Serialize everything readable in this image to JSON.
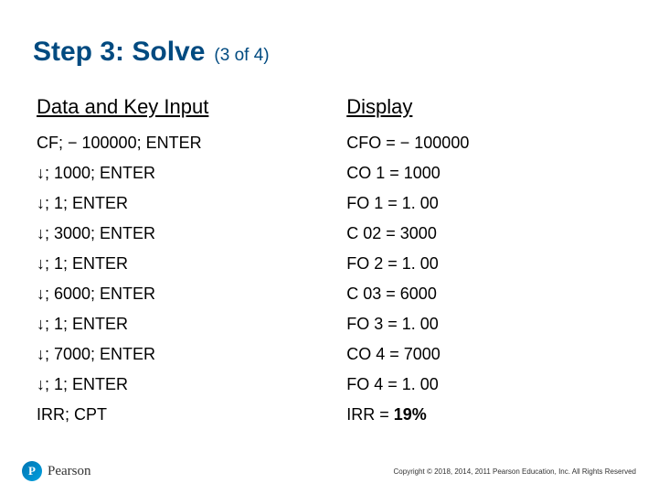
{
  "title": {
    "main": "Step 3: Solve",
    "sub": "(3 of 4)"
  },
  "table": {
    "headers": {
      "input": "Data and Key Input",
      "display": "Display"
    },
    "rows": [
      {
        "input": "CF; − 100000; ENTER",
        "display": "CFO = − 100000"
      },
      {
        "input": " ↓; 1000; ENTER",
        "display": "CO 1 = 1000"
      },
      {
        "input": " ↓; 1; ENTER",
        "display": "FO 1 = 1. 00"
      },
      {
        "input": " ↓; 3000; ENTER",
        "display": "C 02 = 3000"
      },
      {
        "input": " ↓; 1; ENTER",
        "display": "FO 2 = 1. 00"
      },
      {
        "input": " ↓; 6000; ENTER",
        "display": "C 03 = 6000"
      },
      {
        "input": " ↓;  1; ENTER",
        "display": "FO 3 = 1. 00"
      },
      {
        "input": " ↓;  7000; ENTER",
        "display": "CO 4 = 7000"
      },
      {
        "input": " ↓; 1; ENTER",
        "display": "FO 4 = 1. 00"
      },
      {
        "input": "IRR; CPT",
        "display_prefix": "IRR = ",
        "display_bold": "19%"
      }
    ]
  },
  "brand": {
    "mark": "P",
    "name": "Pearson"
  },
  "copyright": "Copyright © 2018, 2014, 2011 Pearson Education, Inc. All Rights Reserved"
}
